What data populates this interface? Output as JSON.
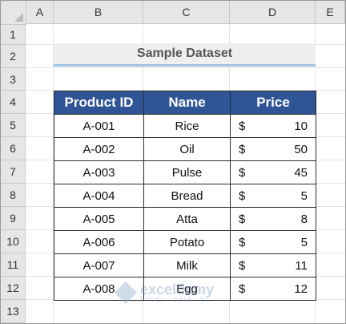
{
  "columns": [
    "A",
    "B",
    "C",
    "D",
    "E"
  ],
  "rows": [
    "1",
    "2",
    "3",
    "4",
    "5",
    "6",
    "7",
    "8",
    "9",
    "10",
    "11",
    "12",
    "13"
  ],
  "title": "Sample Dataset",
  "table": {
    "headers": [
      "Product ID",
      "Name",
      "Price"
    ],
    "rows": [
      {
        "id": "A-001",
        "name": "Rice",
        "currency": "$",
        "price": "10"
      },
      {
        "id": "A-002",
        "name": "Oil",
        "currency": "$",
        "price": "50"
      },
      {
        "id": "A-003",
        "name": "Pulse",
        "currency": "$",
        "price": "45"
      },
      {
        "id": "A-004",
        "name": "Bread",
        "currency": "$",
        "price": "5"
      },
      {
        "id": "A-005",
        "name": "Atta",
        "currency": "$",
        "price": "8"
      },
      {
        "id": "A-006",
        "name": "Potato",
        "currency": "$",
        "price": "5"
      },
      {
        "id": "A-007",
        "name": "Milk",
        "currency": "$",
        "price": "11"
      },
      {
        "id": "A-008",
        "name": "Egg",
        "currency": "$",
        "price": "12"
      }
    ]
  },
  "watermark": {
    "name": "exceldemy",
    "tagline": "EXCEL · DATA · BI"
  },
  "colors": {
    "header_fill": "#2f5597",
    "title_fill": "#efefef",
    "title_underline": "#9fc3e0"
  }
}
